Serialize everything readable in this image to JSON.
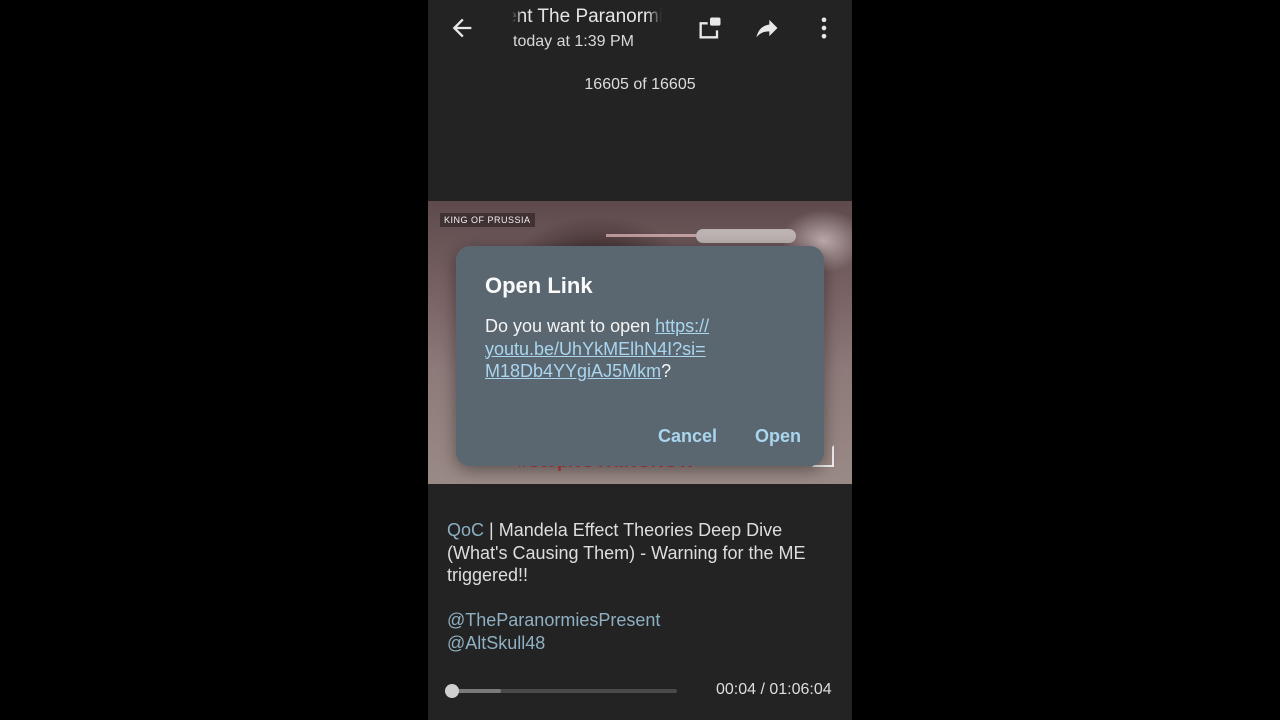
{
  "header": {
    "title": "The Paranormies Present   The Paranormies Present",
    "subtitle": "today at 1:39 PM",
    "icons": {
      "back": "arrow-back-icon",
      "pip": "picture-in-picture-icon",
      "share": "share-forward-icon",
      "more": "more-vert-icon"
    }
  },
  "media_counter": "16605 of 16605",
  "video": {
    "watermark": "KING OF PRUSSIA",
    "banner_text": "#StopNOTHINGNOW",
    "fullscreen_icon": "fullscreen-icon"
  },
  "dialog": {
    "title": "Open Link",
    "prompt_prefix": "Do you want to open ",
    "url": "https://youtu.be/UhYkMElhN4I?si=M18Db4YYgiAJ5Mkm",
    "prompt_suffix": "?",
    "cancel_label": "Cancel",
    "open_label": "Open"
  },
  "caption": {
    "tag": "QoC",
    "text": " | Mandela Effect Theories Deep Dive (What's Causing Them) - Warning for the ME triggered!!",
    "mentions": [
      "@TheParanormiesPresent",
      "@AltSkull48"
    ]
  },
  "player": {
    "current_time": "00:04",
    "duration": "01:06:04",
    "time_display": "00:04 / 01:06:04",
    "progress_fraction": 0.001,
    "buffered_fraction": 0.24
  },
  "colors": {
    "background": "#232323",
    "dialog": "#5b6770",
    "accent": "#a9d5ee",
    "link": "#8eb0c2"
  }
}
